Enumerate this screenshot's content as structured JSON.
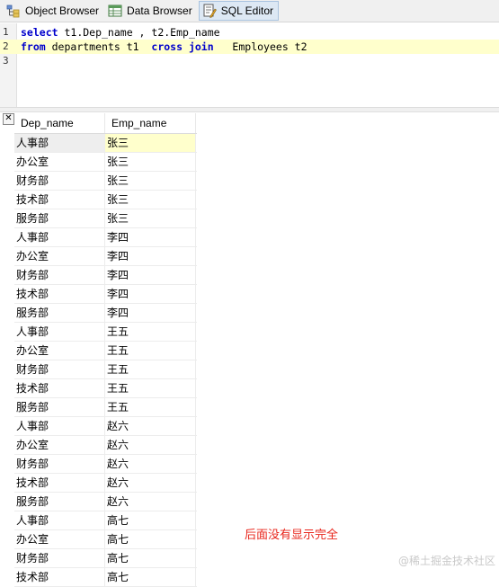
{
  "tabs": [
    {
      "label": "Object Browser",
      "icon": "object-browser-icon",
      "active": false
    },
    {
      "label": "Data Browser",
      "icon": "data-browser-icon",
      "active": false
    },
    {
      "label": "SQL Editor",
      "icon": "sql-editor-icon",
      "active": true
    }
  ],
  "editor": {
    "lines": [
      {
        "num": "1",
        "parts": [
          [
            "kw",
            "select"
          ],
          [
            "t",
            " t1.Dep_name , t2.Emp_name"
          ]
        ]
      },
      {
        "num": "2",
        "parts": [
          [
            "kw",
            "from"
          ],
          [
            "t",
            " departments t1  "
          ],
          [
            "kw",
            "cross join"
          ],
          [
            "t",
            "   Employees t2"
          ]
        ]
      },
      {
        "num": "3",
        "parts": []
      }
    ]
  },
  "results": {
    "columns": [
      "Dep_name",
      "Emp_name"
    ],
    "rows": [
      [
        "人事部",
        "张三"
      ],
      [
        "办公室",
        "张三"
      ],
      [
        "财务部",
        "张三"
      ],
      [
        "技术部",
        "张三"
      ],
      [
        "服务部",
        "张三"
      ],
      [
        "人事部",
        "李四"
      ],
      [
        "办公室",
        "李四"
      ],
      [
        "财务部",
        "李四"
      ],
      [
        "技术部",
        "李四"
      ],
      [
        "服务部",
        "李四"
      ],
      [
        "人事部",
        "王五"
      ],
      [
        "办公室",
        "王五"
      ],
      [
        "财务部",
        "王五"
      ],
      [
        "技术部",
        "王五"
      ],
      [
        "服务部",
        "王五"
      ],
      [
        "人事部",
        "赵六"
      ],
      [
        "办公室",
        "赵六"
      ],
      [
        "财务部",
        "赵六"
      ],
      [
        "技术部",
        "赵六"
      ],
      [
        "服务部",
        "赵六"
      ],
      [
        "人事部",
        "高七"
      ],
      [
        "办公室",
        "高七"
      ],
      [
        "财务部",
        "高七"
      ],
      [
        "技术部",
        "高七"
      ]
    ]
  },
  "annotation": "后面没有显示完全",
  "watermark": "@稀土掘金技术社区",
  "colors": {
    "keyword": "#0000cc",
    "highlight": "#ffffcc",
    "annotation": "#e8251b"
  }
}
